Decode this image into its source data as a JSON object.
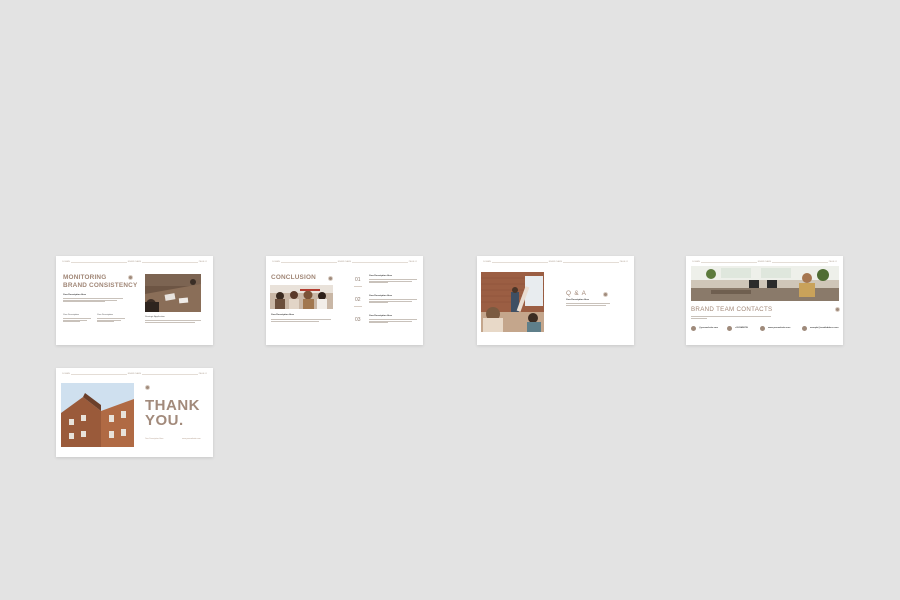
{
  "colors": {
    "background": "#e3e3e3",
    "slide": "#ffffff",
    "accent": "#a08676"
  },
  "common": {
    "topbar_left": "DOMAIN",
    "topbar_center": "BRAND NAME",
    "topbar_right": "PAGE 01"
  },
  "slides": [
    {
      "title_line1": "MONITORING",
      "title_line2": "BRAND CONSISTENCY",
      "sub_heading": "Your Description Here",
      "col1_heading": "Your Description",
      "col2_heading": "Your Description",
      "right_heading": "Strategic Application"
    },
    {
      "title": "CONCLUSION",
      "sub_heading": "Your Description Here",
      "items": [
        {
          "num": "01",
          "heading": "Your Description Here"
        },
        {
          "num": "02",
          "heading": "Your Description Here"
        },
        {
          "num": "03",
          "heading": "Your Description Here"
        }
      ]
    },
    {
      "title": "Q & A",
      "sub_heading": "Your Description Here"
    },
    {
      "title": "BRAND TEAM CONTACTS",
      "contacts": [
        {
          "icon": "at-icon",
          "text": "@yourwebsite.com"
        },
        {
          "icon": "phone-icon",
          "text": "+0123456789"
        },
        {
          "icon": "globe-icon",
          "text": "www.yourwebsite.com"
        },
        {
          "icon": "mail-icon",
          "text": "example@emailaddress.com"
        }
      ]
    },
    {
      "title_line1": "THANK",
      "title_line2": "YOU.",
      "left_caption": "Your Description Here",
      "right_caption": "www.yourwebsite.com"
    }
  ]
}
